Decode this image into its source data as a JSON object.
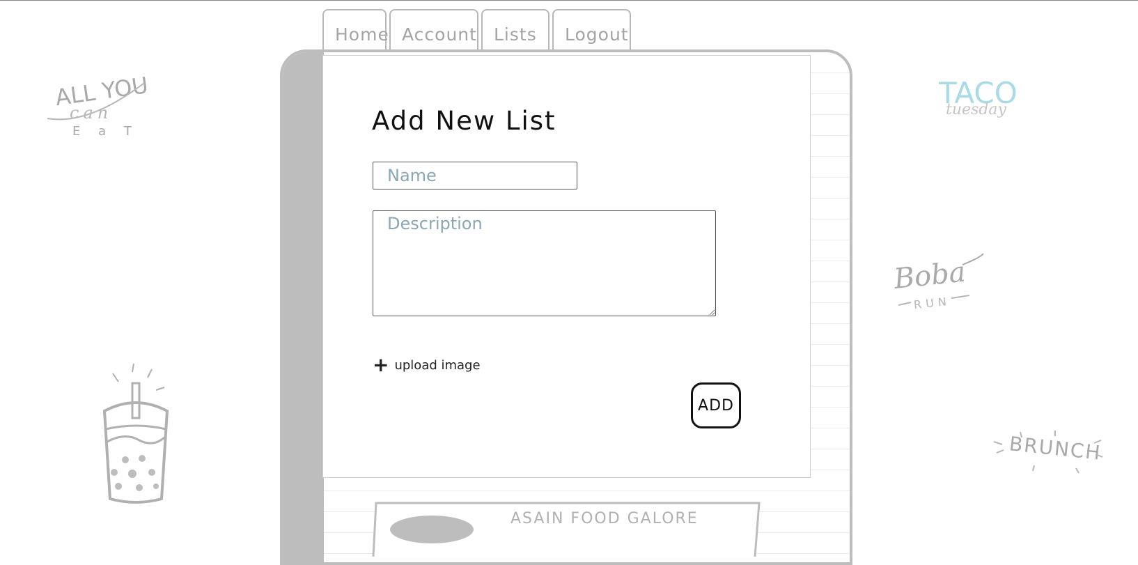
{
  "nav": {
    "tabs": [
      {
        "label": "Home"
      },
      {
        "label": "Account"
      },
      {
        "label": "Lists"
      },
      {
        "label": "Logout"
      }
    ]
  },
  "form": {
    "title": "Add New List",
    "name_placeholder": "Name",
    "description_placeholder": "Description",
    "upload_label": "upload image",
    "add_label": "ADD"
  },
  "list_card": {
    "title": "ASAIN FOOD GALORE"
  },
  "doodles": {
    "all_you": "ALL YOU",
    "can": "can",
    "eat": "E a T",
    "taco": "TACO",
    "tuesday": "tuesday",
    "boba": "Boba",
    "run": "RUN",
    "brunch": "BRUNCH"
  },
  "colors": {
    "frame_gray": "#bdbdbd",
    "placeholder_blue": "#8aa7b6",
    "taco_blue": "#a8dbe6"
  }
}
